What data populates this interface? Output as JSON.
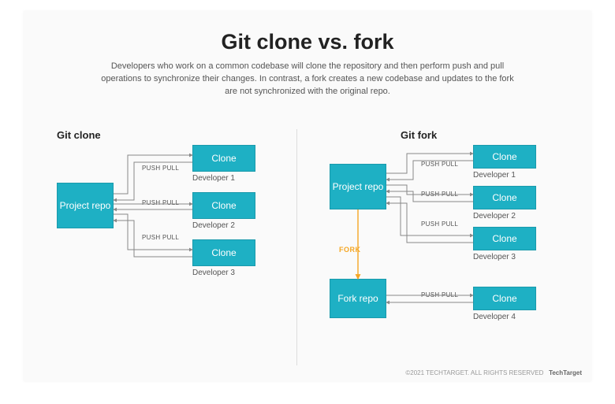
{
  "title": "Git clone vs. fork",
  "subtitle": "Developers who work on a common codebase will clone the repository and then perform push and pull operations to synchronize their changes. In contrast, a fork creates a new codebase and updates to the fork are not synchronized with the original repo.",
  "left": {
    "heading": "Git clone",
    "repo": "Project repo",
    "clones": [
      {
        "box": "Clone",
        "edge": "PUSH PULL",
        "dev": "Developer 1"
      },
      {
        "box": "Clone",
        "edge": "PUSH PULL",
        "dev": "Developer 2"
      },
      {
        "box": "Clone",
        "edge": "PUSH PULL",
        "dev": "Developer 3"
      }
    ]
  },
  "right": {
    "heading": "Git fork",
    "repo": "Project repo",
    "fork_repo": "Fork repo",
    "fork_edge": "FORK",
    "clones": [
      {
        "box": "Clone",
        "edge": "PUSH PULL",
        "dev": "Developer 1"
      },
      {
        "box": "Clone",
        "edge": "PUSH PULL",
        "dev": "Developer 2"
      },
      {
        "box": "Clone",
        "edge": "PUSH PULL",
        "dev": "Developer 3"
      },
      {
        "box": "Clone",
        "edge": "PUSH PULL",
        "dev": "Developer 4"
      }
    ]
  },
  "attribution": {
    "copyright": "©2021 TECHTARGET. ALL RIGHTS RESERVED",
    "brand": "TechTarget"
  }
}
